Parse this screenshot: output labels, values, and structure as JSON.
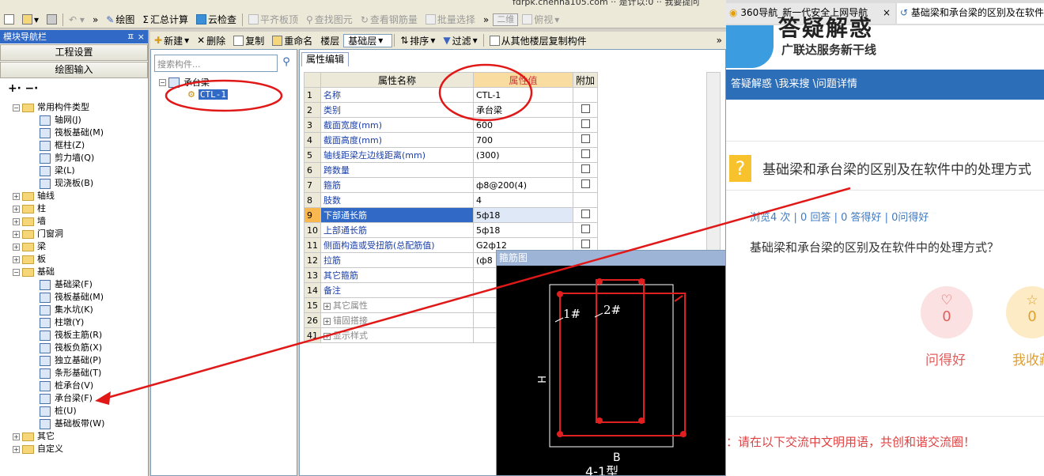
{
  "app": {
    "top_strip_text": "fdrpk.chenna105.com ·· 是计以:0 ·· 我要提问",
    "toolbar": [
      "绘图",
      "汇总计算",
      "云检查",
      "平齐板顶",
      "查找图元",
      "查看钢筋量",
      "批量选择",
      "二维",
      "俯视"
    ],
    "module_nav": {
      "title": "模块导航栏",
      "pin": "ㅍ ×",
      "buttons": [
        "工程设置",
        "绘图输入"
      ]
    },
    "tree": [
      {
        "label": "常用构件类型",
        "exp": "−",
        "level": 0,
        "folder": true
      },
      {
        "label": "轴网(J)",
        "level": 1
      },
      {
        "label": "筏板基础(M)",
        "level": 1
      },
      {
        "label": "框柱(Z)",
        "level": 1
      },
      {
        "label": "剪力墙(Q)",
        "level": 1
      },
      {
        "label": "梁(L)",
        "level": 1
      },
      {
        "label": "现浇板(B)",
        "level": 1
      },
      {
        "label": "轴线",
        "exp": "+",
        "level": 0,
        "folder": true
      },
      {
        "label": "柱",
        "exp": "+",
        "level": 0,
        "folder": true
      },
      {
        "label": "墙",
        "exp": "+",
        "level": 0,
        "folder": true
      },
      {
        "label": "门窗洞",
        "exp": "+",
        "level": 0,
        "folder": true
      },
      {
        "label": "梁",
        "exp": "+",
        "level": 0,
        "folder": true
      },
      {
        "label": "板",
        "exp": "+",
        "level": 0,
        "folder": true
      },
      {
        "label": "基础",
        "exp": "−",
        "level": 0,
        "folder": true
      },
      {
        "label": "基础梁(F)",
        "level": 1
      },
      {
        "label": "筏板基础(M)",
        "level": 1
      },
      {
        "label": "集水坑(K)",
        "level": 1
      },
      {
        "label": "柱墩(Y)",
        "level": 1
      },
      {
        "label": "筏板主筋(R)",
        "level": 1
      },
      {
        "label": "筏板负筋(X)",
        "level": 1
      },
      {
        "label": "独立基础(P)",
        "level": 1
      },
      {
        "label": "条形基础(T)",
        "level": 1
      },
      {
        "label": "桩承台(V)",
        "level": 1
      },
      {
        "label": "承台梁(F)",
        "level": 1
      },
      {
        "label": "桩(U)",
        "level": 1
      },
      {
        "label": "基础板带(W)",
        "level": 1
      },
      {
        "label": "其它",
        "exp": "+",
        "level": 0,
        "folder": true
      },
      {
        "label": "自定义",
        "exp": "+",
        "level": 0,
        "folder": true
      }
    ],
    "toolbar2": [
      "新建",
      "删除",
      "复制",
      "重命名",
      "楼层",
      "基础层",
      "排序",
      "过滤",
      "从其他楼层复制构件"
    ],
    "search_placeholder": "搜索构件...",
    "component_tree": {
      "parent": "承台梁",
      "child": "CTL-1"
    },
    "prop_tab": "属性编辑",
    "prop_headers": [
      "属性名称",
      "属性值",
      "附加"
    ],
    "props": [
      {
        "n": "1",
        "name": "名称",
        "val": "CTL-1",
        "cb": false
      },
      {
        "n": "2",
        "name": "类别",
        "val": "承台梁",
        "cb": true
      },
      {
        "n": "3",
        "name": "截面宽度(mm)",
        "val": "600",
        "cb": true
      },
      {
        "n": "4",
        "name": "截面高度(mm)",
        "val": "700",
        "cb": true
      },
      {
        "n": "5",
        "name": "轴线距梁左边线距离(mm)",
        "val": "(300)",
        "cb": true
      },
      {
        "n": "6",
        "name": "跨数量",
        "val": "",
        "cb": true
      },
      {
        "n": "7",
        "name": "箍筋",
        "val": "ф8@200(4)",
        "cb": true
      },
      {
        "n": "8",
        "name": "肢数",
        "val": "4",
        "cb": false
      },
      {
        "n": "9",
        "name": "下部通长筋",
        "val": "5ф18",
        "cb": true,
        "sel": true
      },
      {
        "n": "10",
        "name": "上部通长筋",
        "val": "5ф18",
        "cb": true
      },
      {
        "n": "11",
        "name": "侧面构造或受扭筋(总配筋值)",
        "val": "G2ф12",
        "cb": true
      },
      {
        "n": "12",
        "name": "拉筋",
        "val": "(ф8",
        "cb": false
      },
      {
        "n": "13",
        "name": "其它箍筋",
        "val": "",
        "cb": false
      },
      {
        "n": "14",
        "name": "备注",
        "val": "",
        "cb": false
      },
      {
        "n": "15",
        "name": "其它属性",
        "val": "",
        "cb": false,
        "grp": true
      },
      {
        "n": "26",
        "name": "锚固搭接",
        "val": "",
        "cb": false,
        "grp": true
      },
      {
        "n": "41",
        "name": "显示样式",
        "val": "",
        "cb": false,
        "grp": true
      }
    ],
    "popup": {
      "title": "箍筋图",
      "label1": "1#",
      "label2": "2#",
      "axis_h": "H",
      "axis_b": "B",
      "type": "4-1型"
    }
  },
  "browser": {
    "tab1": "360导航_新一代安全上网导航",
    "tab2": "基础梁和承台梁的区别及在软件",
    "logo_title": "答疑解惑",
    "logo_sub": "广联达服务新干线",
    "breadcrumb": "答疑解惑 \\我来搜 \\问题详情",
    "q_title": "基础梁和承台梁的区别及在软件中的处理方式",
    "stats": "浏览4 次 | 0 回答 | 0 答得好 | 0问得好",
    "question": "基础梁和承台梁的区别及在软件中的处理方式？",
    "like_count": "0",
    "like_label": "问得好",
    "fav_count": "0",
    "fav_label": "我收藏",
    "notice": "：请在以下交流中文明用语，共创和谐交流圈！"
  }
}
